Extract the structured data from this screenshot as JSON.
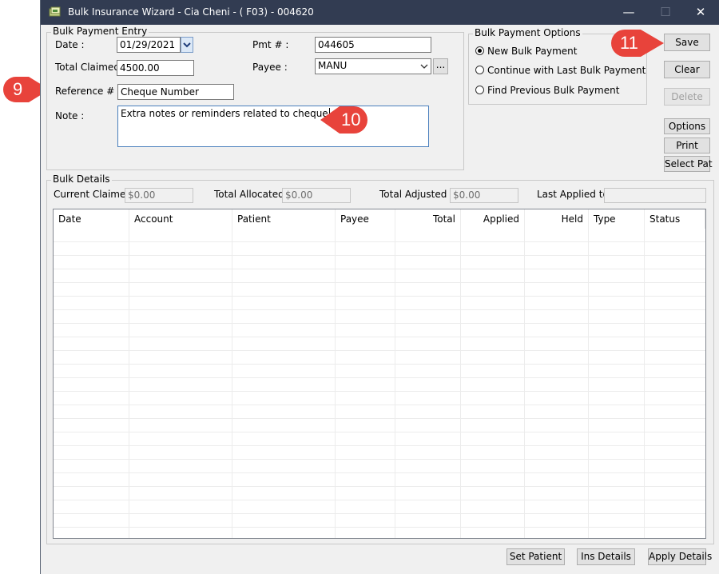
{
  "window": {
    "title": "Bulk Insurance Wizard - Cia Cheni - ( F03) - 004620",
    "minimize_glyph": "—",
    "maximize_glyph": "☐",
    "close_glyph": "✕"
  },
  "entry": {
    "group_label": "Bulk Payment Entry",
    "date_label": "Date :",
    "date_value": "01/29/2021",
    "pmt_label": "Pmt # :",
    "pmt_value": "044605",
    "total_claimed_label": "Total Claimed :",
    "total_claimed_value": "4500.00",
    "payee_label": "Payee :",
    "payee_value": "MANU",
    "payee_browse": "...",
    "reference_label": "Reference # :",
    "reference_value": "Cheque Number",
    "note_label": "Note :",
    "note_value": "Extra notes or reminders related to cheque"
  },
  "options": {
    "group_label": "Bulk Payment Options",
    "items": [
      {
        "label": "New Bulk Payment",
        "checked": true
      },
      {
        "label": "Continue with Last Bulk Payment",
        "checked": false
      },
      {
        "label": "Find Previous Bulk Payment",
        "checked": false
      }
    ]
  },
  "actions": {
    "save": "Save",
    "clear": "Clear",
    "delete": "Delete",
    "options": "Options",
    "print": "Print",
    "select_pat": "Select Pat"
  },
  "details": {
    "group_label": "Bulk Details",
    "current_claimed_label": "Current Claimed :",
    "current_claimed_value": "$0.00",
    "total_allocated_label": "Total Allocated :",
    "total_allocated_value": "$0.00",
    "total_adjusted_label": "Total Adjusted :",
    "total_adjusted_value": "$0.00",
    "last_applied_label": "Last Applied to:",
    "last_applied_value": "",
    "columns": [
      "Date",
      "Account",
      "Patient",
      "Payee",
      "Total",
      "Applied",
      "Held",
      "Type",
      "Status"
    ]
  },
  "bottom": {
    "set_patient": "Set Patient",
    "ins_details": "Ins Details",
    "apply_details": "Apply Details"
  },
  "callouts": [
    "9",
    "10",
    "11"
  ],
  "colors": {
    "titlebar": "#323c52",
    "callout": "#e8433b",
    "window_bg": "#f0f0f0"
  }
}
